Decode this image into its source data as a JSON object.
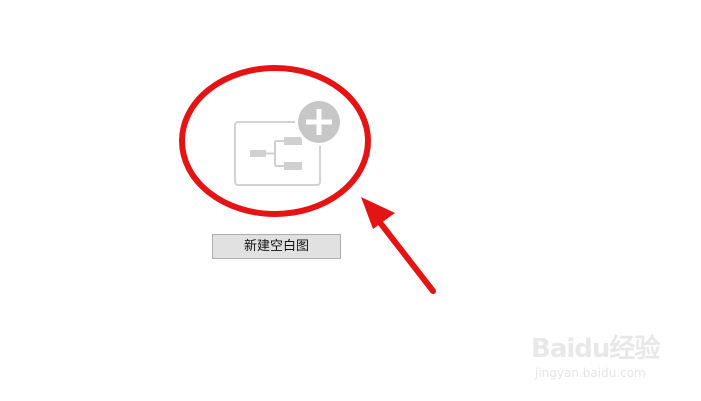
{
  "new_diagram": {
    "button_label": "新建空白图",
    "icon": "mindmap-plus-icon"
  },
  "annotation": {
    "color": "#e31414",
    "shapes": [
      "circle-highlight",
      "arrow-pointer"
    ]
  },
  "watermark": {
    "logo_text": "Baidu经验",
    "url": "jingyan.baidu.com"
  }
}
